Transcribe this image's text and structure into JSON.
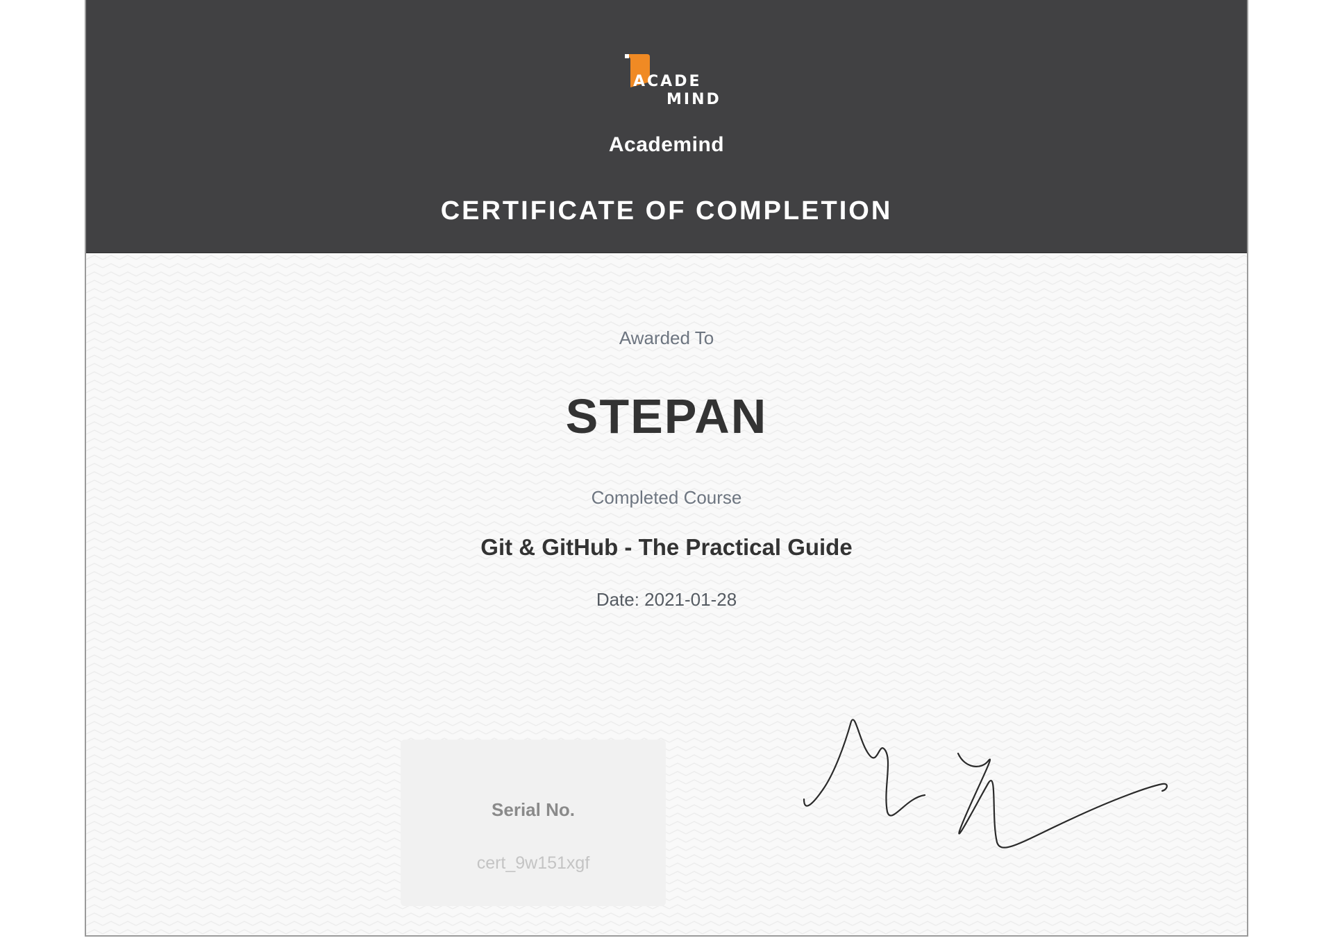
{
  "header": {
    "logo": {
      "icon": "academind-logo-icon",
      "line1": "ACADE",
      "line2": "MIND",
      "accent_color": "#f08a24"
    },
    "brand_name": "Academind",
    "heading": "CERTIFICATE OF COMPLETION",
    "background_color": "#414143"
  },
  "body": {
    "awarded_label": "Awarded To",
    "recipient": "STEPAN",
    "completed_label": "Completed Course",
    "course_title": "Git & GitHub - The Practical Guide",
    "date_line": "Date: 2021-01-28"
  },
  "serial": {
    "label": "Serial No.",
    "value": "cert_9w151xgf"
  },
  "signature": {
    "icon": "handwritten-signature-icon"
  }
}
